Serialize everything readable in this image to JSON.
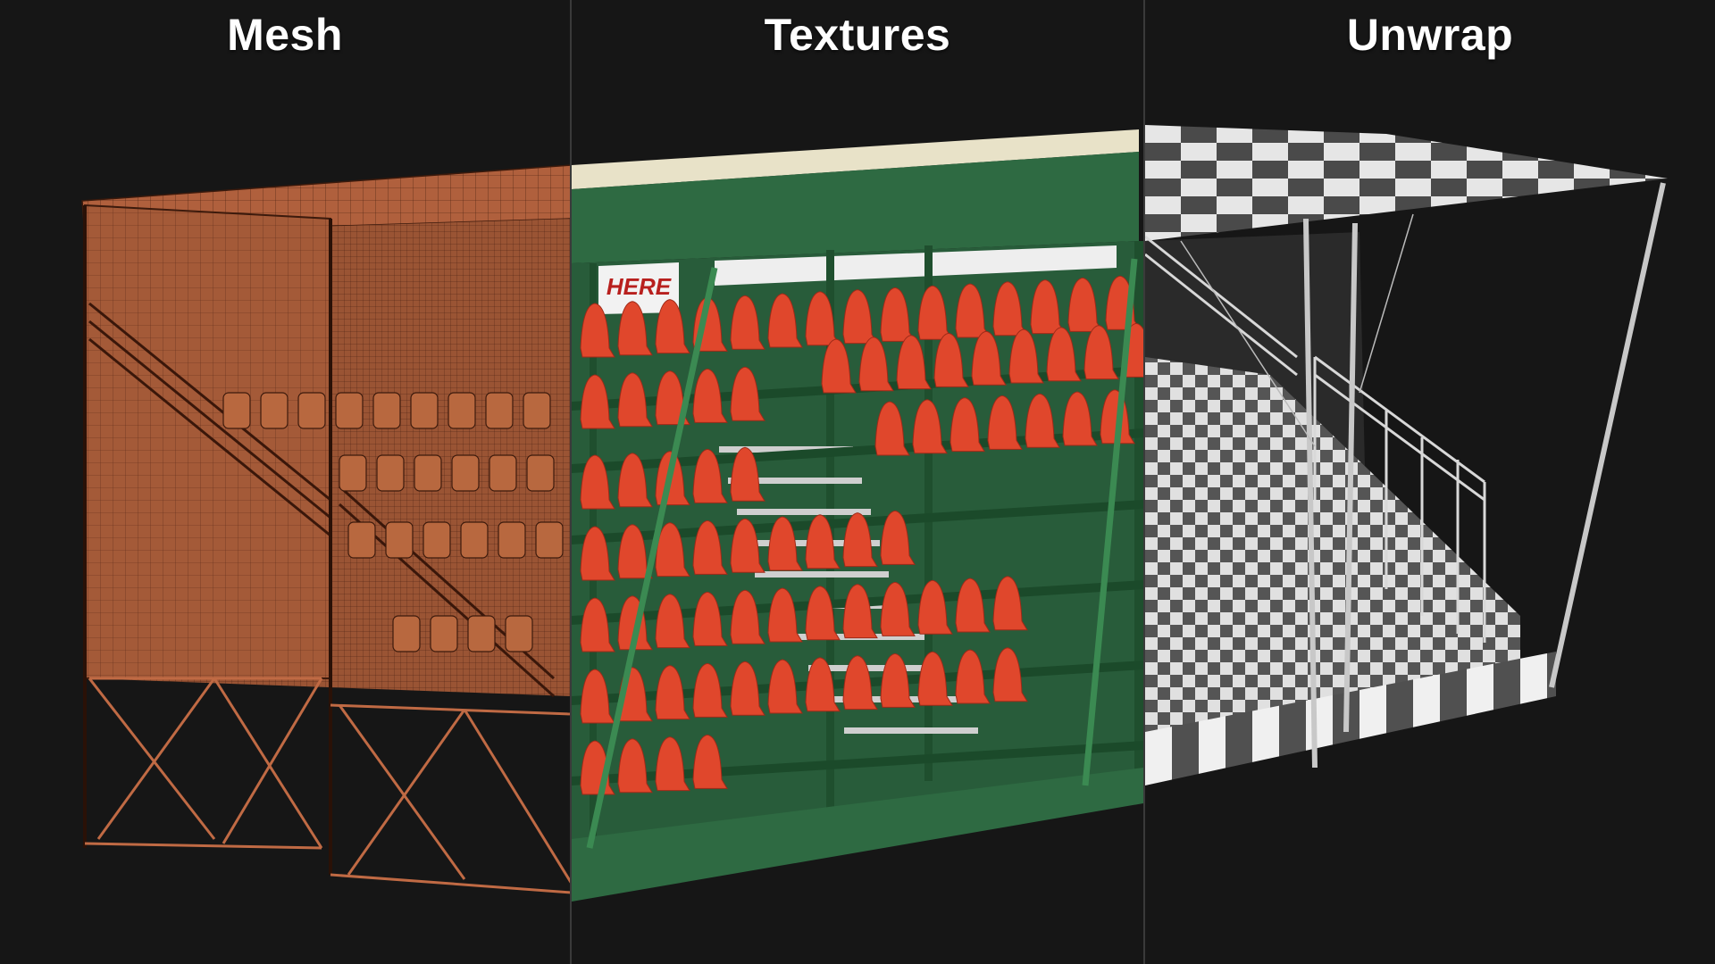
{
  "panels": [
    {
      "title": "Mesh"
    },
    {
      "title": "Textures",
      "banner_text": "HERE"
    },
    {
      "title": "Unwrap"
    }
  ],
  "colors": {
    "background": "#161616",
    "mesh_wire": "#e6774f",
    "mesh_fill": "#8a4a2e",
    "green_structure": "#2e6a42",
    "seat_red": "#e0472c",
    "roof_beige": "#e8e2c8",
    "checker_light": "#e6e6e6",
    "checker_dark": "#4a4a4a"
  }
}
